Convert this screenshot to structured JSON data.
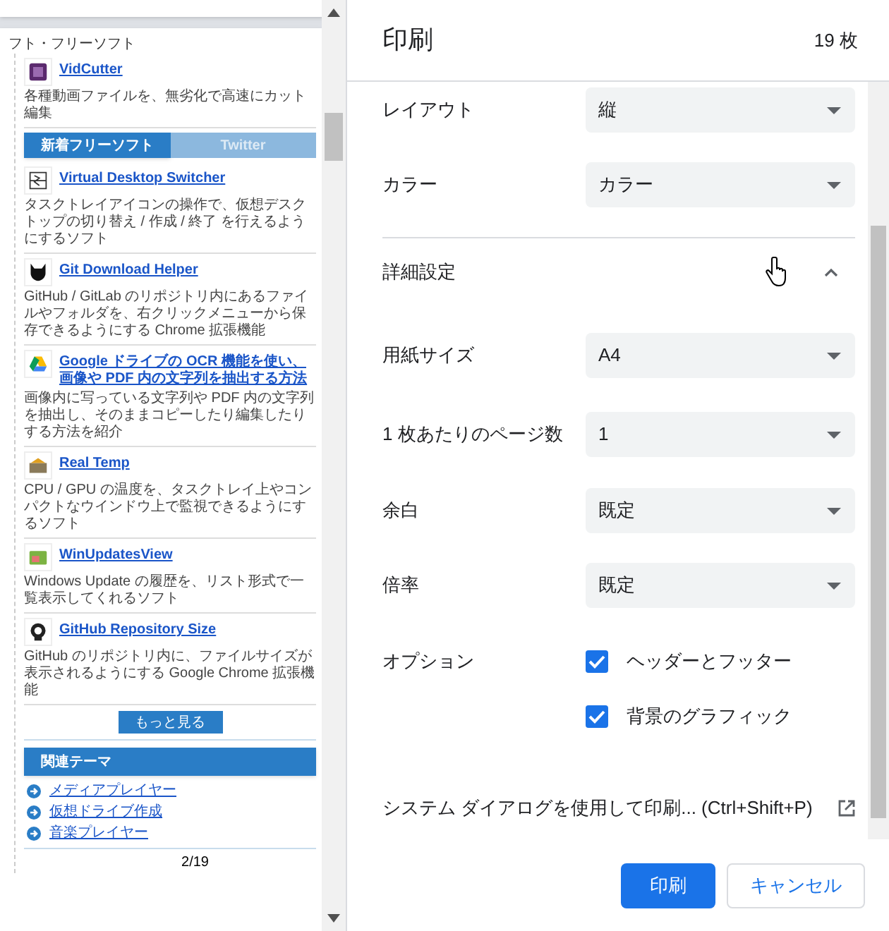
{
  "preview": {
    "header_fragment": "フト・フリーソフト",
    "feature": {
      "title": "VidCutter",
      "description": "各種動画ファイルを、無劣化で高速にカット編集"
    },
    "tabs": [
      {
        "label": "新着フリーソフト",
        "selected": true
      },
      {
        "label": "Twitter",
        "selected": false
      }
    ],
    "entries": [
      {
        "title": "Virtual Desktop Switcher",
        "description": "タスクトレイアイコンの操作で、仮想デスクトップの切り替え / 作成 / 終了 を行えるようにするソフト"
      },
      {
        "title": "Git Download Helper",
        "description": "GitHub / GitLab のリポジトリ内にあるファイルやフォルダを、右クリックメニューから保存できるようにする Chrome 拡張機能"
      },
      {
        "title": "Google ドライブの OCR 機能を使い、画像や PDF 内の文字列を抽出する方法",
        "description": "画像内に写っている文字列や PDF 内の文字列を抽出し、そのままコピーしたり編集したりする方法を紹介"
      },
      {
        "title": "Real Temp",
        "description": "CPU / GPU の温度を、タスクトレイ上やコンパクトなウインドウ上で監視できるようにするソフト"
      },
      {
        "title": "WinUpdatesView",
        "description": "Windows Update の履歴を、リスト形式で一覧表示してくれるソフト"
      },
      {
        "title": "GitHub Repository Size",
        "description": "GitHub のリポジトリ内に、ファイルサイズが表示されるようにする Google Chrome 拡張機能"
      }
    ],
    "more_button": "もっと見る",
    "related": {
      "title": "関連テーマ",
      "links": [
        "メディアプレイヤー",
        "仮想ドライブ作成",
        "音楽プレイヤー"
      ]
    },
    "page_number": "2/19"
  },
  "print": {
    "title": "印刷",
    "sheets": "19 枚",
    "settings": [
      {
        "kind": "select",
        "label": "レイアウト",
        "value": "縦"
      },
      {
        "kind": "select",
        "label": "カラー",
        "value": "カラー"
      },
      {
        "kind": "section",
        "label": "詳細設定",
        "expanded": true
      },
      {
        "kind": "select",
        "label": "用紙サイズ",
        "value": "A4"
      },
      {
        "kind": "select",
        "label": "1 枚あたりのページ数",
        "value": "1"
      },
      {
        "kind": "select",
        "label": "余白",
        "value": "既定"
      },
      {
        "kind": "select",
        "label": "倍率",
        "value": "既定"
      },
      {
        "kind": "checkboxes",
        "label": "オプション",
        "options": [
          {
            "label": "ヘッダーとフッター",
            "checked": true
          },
          {
            "label": "背景のグラフィック",
            "checked": true
          }
        ]
      },
      {
        "kind": "link",
        "label": "システム ダイアログを使用して印刷... (Ctrl+Shift+P)"
      }
    ],
    "buttons": [
      {
        "label": "印刷",
        "kind": "primary"
      },
      {
        "label": "キャンセル",
        "kind": "secondary"
      }
    ]
  }
}
